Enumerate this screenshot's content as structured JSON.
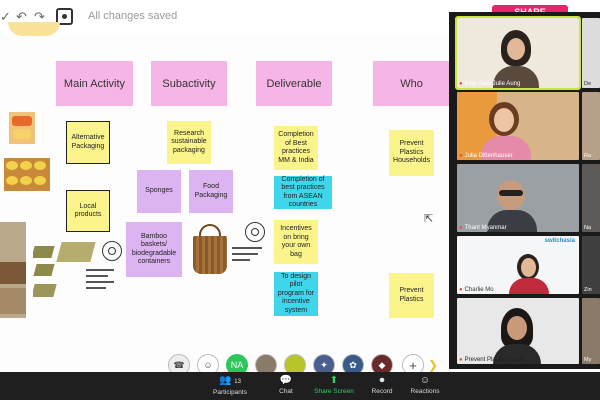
{
  "toolbar": {
    "status_text": "All changes saved",
    "share_label": "SHARE"
  },
  "board": {
    "headers": {
      "main_activity": "Main Activity",
      "subactivity": "Subactivity",
      "deliverable": "Deliverable",
      "who": "Who"
    },
    "notes": {
      "alt_packaging": "Alternative Packaging",
      "local_products": "Local products",
      "research_sustainable": "Research sustainable packaging",
      "sponges": "Sponges",
      "food_packaging": "Food Packaging",
      "bamboo": "Bamboo baskets/ biodegradable containers",
      "best_practices_mm": "Completion of Best practices MM & India",
      "best_practices_asean": "Completion of best practices from ASEAN countries",
      "incentives": "Incentives on bring your own bag",
      "pilot_program": "To design pilot program for incentive system",
      "prevent_households": "Prevent Plastics Households",
      "prevent_plastics": "Prevent Plastics"
    }
  },
  "video": {
    "participants": [
      {
        "name": "Engr Naw Julie Aung",
        "active": true
      },
      {
        "name": "Julia Dittenhauser",
        "active": false
      },
      {
        "name": "Thant Myanmar",
        "active": false
      },
      {
        "name": "Charlie Mo",
        "active": false
      },
      {
        "name": "Prevent Plastics Myan...",
        "active": false
      }
    ],
    "side_labels": [
      "De",
      "Ra",
      "Na",
      "Zin",
      "My"
    ],
    "tile_watermark": "switchasia"
  },
  "canvas_circles": {
    "initials": "NA",
    "plus": "+"
  },
  "meeting_bar": {
    "participants_label": "Participants",
    "participants_count": "13",
    "chat_label": "Chat",
    "share_label": "Share Screen",
    "record_label": "Record",
    "reactions_label": "Reactions"
  },
  "colors": {
    "header_pink": "#f6b5e7",
    "note_yellow": "#fbf48a",
    "note_purple": "#dcb4f1",
    "note_cyan": "#3fd6ec",
    "share_green": "#2ed162",
    "share_pink": "#e8246b"
  }
}
